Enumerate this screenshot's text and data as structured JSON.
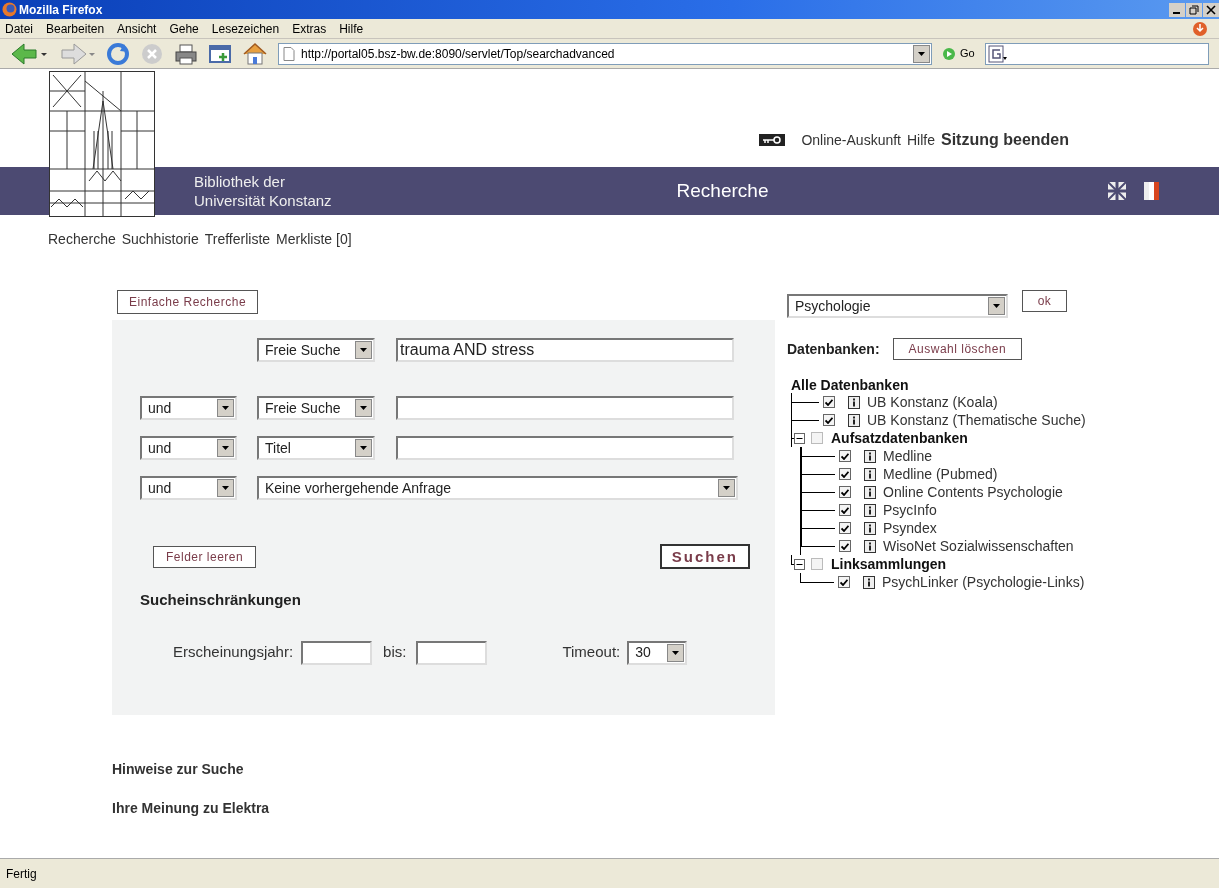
{
  "window": {
    "title": "Mozilla Firefox"
  },
  "menu": [
    "Datei",
    "Bearbeiten",
    "Ansicht",
    "Gehe",
    "Lesezeichen",
    "Extras",
    "Hilfe"
  ],
  "toolbar": {
    "url": "http://portal05.bsz-bw.de:8090/servlet/Top/searchadvanced",
    "go": "Go"
  },
  "header": {
    "top_links": [
      {
        "text": "Online-Auskunft",
        "bold": false
      },
      {
        "text": "Hilfe",
        "bold": false
      },
      {
        "text": "Sitzung beenden",
        "bold": true
      }
    ],
    "library_name": [
      "Bibliothek der",
      "Universität Konstanz"
    ],
    "title": "Recherche"
  },
  "nav": [
    "Recherche",
    "Suchhistorie",
    "Trefferliste",
    "Merkliste [0]"
  ],
  "search": {
    "simple_button": "Einfache Recherche",
    "rows": [
      {
        "kind": "field",
        "field": "Freie Suche",
        "value": "trauma AND stress"
      },
      {
        "kind": "field",
        "operator": "und",
        "field": "Freie Suche"
      },
      {
        "kind": "field",
        "operator": "und",
        "field": "Titel"
      },
      {
        "kind": "query",
        "operator": "und",
        "field": "Keine vorhergehende Anfrage"
      }
    ],
    "clear_button": "Felder leeren",
    "search_button": "Suchen",
    "restrictions_title": "Sucheinschränkungen",
    "year_label": "Erscheinungsjahr:",
    "to_label": "bis:",
    "timeout_label": "Timeout:",
    "timeout": "30"
  },
  "databases": {
    "collection": "Psychologie",
    "ok": "ok",
    "label": "Datenbanken:",
    "clear": "Auswahl löschen",
    "tree": {
      "label": "Alle Datenbanken",
      "children": [
        {
          "label": "UB Konstanz (Koala)",
          "checked": true
        },
        {
          "label": "UB Konstanz (Thematische Suche)",
          "checked": true
        },
        {
          "label": "Aufsatzdatenbanken",
          "checked": false,
          "expanded": true,
          "children": [
            {
              "label": "Medline",
              "checked": true
            },
            {
              "label": "Medline (Pubmed)",
              "checked": true
            },
            {
              "label": "Online Contents Psychologie",
              "checked": true
            },
            {
              "label": "PsycInfo",
              "checked": true
            },
            {
              "label": "Psyndex",
              "checked": true
            },
            {
              "label": "WisoNet Sozialwissenschaften",
              "checked": true
            }
          ]
        },
        {
          "label": "Linksammlungen",
          "checked": false,
          "expanded": true,
          "children": [
            {
              "label": "PsychLinker (Psychologie-Links)",
              "checked": true
            }
          ]
        }
      ]
    }
  },
  "footer_links": [
    "Hinweise zur Suche",
    "Ihre Meinung zu Elektra"
  ],
  "status_bar": "Fertig"
}
